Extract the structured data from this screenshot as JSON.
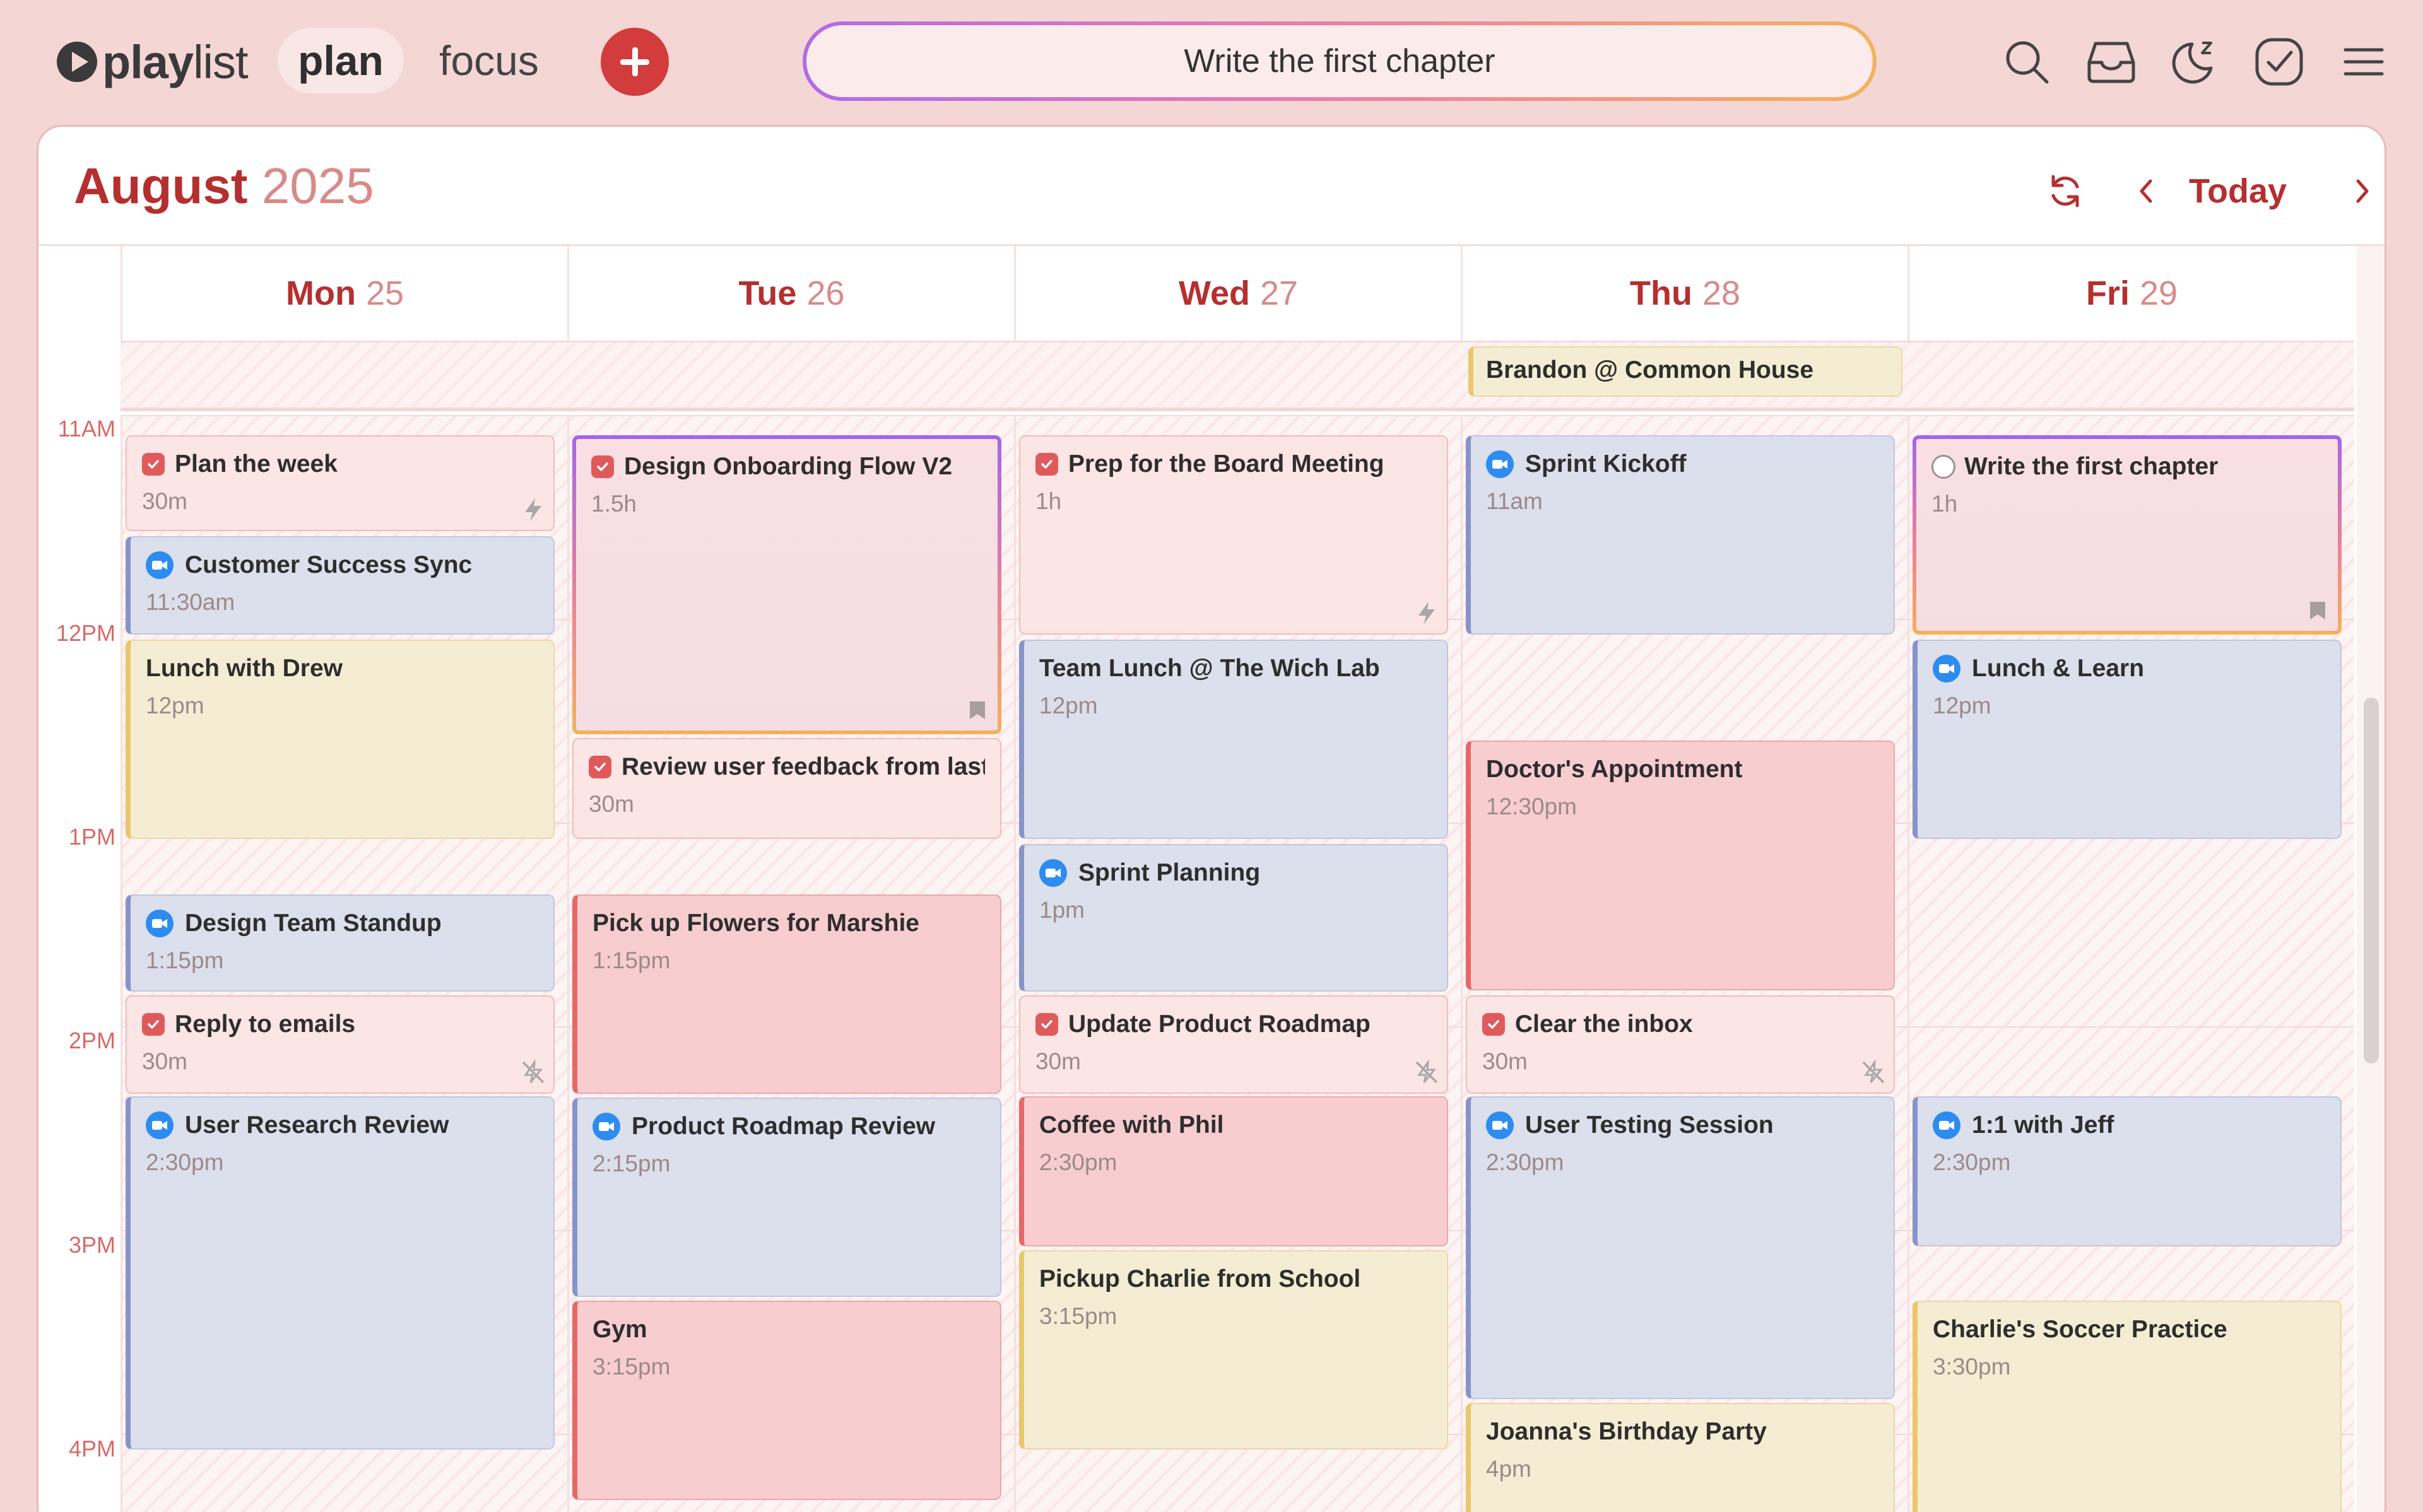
{
  "app": {
    "logo_text_bold": "play",
    "logo_text": "list"
  },
  "nav": {
    "plan": "plan",
    "focus": "focus"
  },
  "focus_task": "Write the first chapter",
  "calendar": {
    "month": "August",
    "year": "2025",
    "today_label": "Today",
    "days": [
      {
        "name": "Mon",
        "date": "25"
      },
      {
        "name": "Tue",
        "date": "26"
      },
      {
        "name": "Wed",
        "date": "27"
      },
      {
        "name": "Thu",
        "date": "28"
      },
      {
        "name": "Fri",
        "date": "29"
      }
    ],
    "hours": [
      "11AM",
      "12PM",
      "1PM",
      "2PM",
      "3PM",
      "4PM"
    ],
    "allday": {
      "title": "Brandon @ Common House"
    },
    "events": {
      "mon_plan": {
        "title": "Plan the week",
        "sub": "30m"
      },
      "mon_css": {
        "title": "Customer Success Sync",
        "sub": "11:30am"
      },
      "mon_lunch": {
        "title": "Lunch with Drew",
        "sub": "12pm"
      },
      "mon_standup": {
        "title": "Design Team Standup",
        "sub": "1:15pm"
      },
      "mon_emails": {
        "title": "Reply to emails",
        "sub": "30m"
      },
      "mon_urr": {
        "title": "User Research Review",
        "sub": "2:30pm"
      },
      "tue_onboard": {
        "title": "Design Onboarding Flow V2",
        "sub": "1.5h"
      },
      "tue_feedback": {
        "title": "Review user feedback from last r",
        "sub": "30m"
      },
      "tue_flowers": {
        "title": "Pick up Flowers for Marshie",
        "sub": "1:15pm"
      },
      "tue_prr": {
        "title": "Product Roadmap Review",
        "sub": "2:15pm"
      },
      "tue_gym": {
        "title": "Gym",
        "sub": "3:15pm"
      },
      "wed_board": {
        "title": "Prep for the Board Meeting",
        "sub": "1h"
      },
      "wed_lunch": {
        "title": "Team Lunch @ The Wich Lab",
        "sub": "12pm"
      },
      "wed_sprint": {
        "title": "Sprint Planning",
        "sub": "1pm"
      },
      "wed_roadmap": {
        "title": "Update Product Roadmap",
        "sub": "30m"
      },
      "wed_coffee": {
        "title": "Coffee with Phil",
        "sub": "2:30pm"
      },
      "wed_charlie": {
        "title": "Pickup Charlie from School",
        "sub": "3:15pm"
      },
      "thu_kickoff": {
        "title": "Sprint Kickoff",
        "sub": "11am"
      },
      "thu_doctor": {
        "title": "Doctor's Appointment",
        "sub": "12:30pm"
      },
      "thu_inbox": {
        "title": "Clear the inbox",
        "sub": "30m"
      },
      "thu_testing": {
        "title": "User Testing Session",
        "sub": "2:30pm"
      },
      "thu_bday": {
        "title": "Joanna's Birthday Party",
        "sub": "4pm"
      },
      "fri_chapter": {
        "title": "Write the first chapter",
        "sub": "1h"
      },
      "fri_learn": {
        "title": "Lunch & Learn",
        "sub": "12pm"
      },
      "fri_jeff": {
        "title": "1:1 with Jeff",
        "sub": "2:30pm"
      },
      "fri_soccer": {
        "title": "Charlie's Soccer Practice",
        "sub": "3:30pm"
      }
    }
  },
  "colors": {
    "accent": "#b52f2f",
    "add_button": "#d23c3c",
    "task_check": "#df5b5b",
    "meeting_icon": "#2d8cf0"
  },
  "icons": [
    "search-icon",
    "inbox-icon",
    "moon-sleep-icon",
    "check-circle-icon",
    "menu-icon",
    "refresh-icon",
    "chevron-left-icon",
    "chevron-right-icon",
    "video-icon",
    "lightning-icon",
    "no-lightning-icon",
    "bookmark-icon"
  ]
}
